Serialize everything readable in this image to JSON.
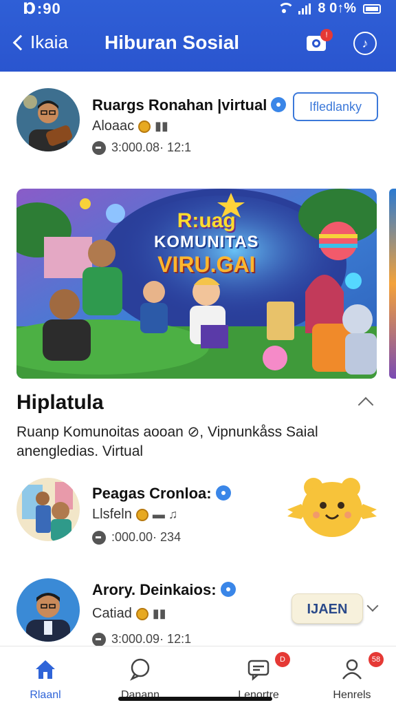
{
  "status_bar": {
    "time": "Ɒ:90",
    "right_text": "8 0↑%"
  },
  "header": {
    "back_label": "Ikaia",
    "title": "Hiburan Sosial",
    "camera_badge": "!"
  },
  "profiles": [
    {
      "name": "Ruargs Ronahan |virtual",
      "sub": "Aloaac",
      "meta": "3:000.08· 12:1",
      "follow_label": "Ifledlanky"
    },
    {
      "name": "Peagas Cronloa:",
      "sub": "Llsfeln",
      "meta": ":000.00· 234"
    },
    {
      "name": "Arory. Deinkaios:",
      "sub": "Catiad",
      "meta": "3:000.09· 12:1",
      "join_label": "IJAEN"
    }
  ],
  "banner": {
    "line1": "R:uag",
    "line2": "KOMUNITAS",
    "line3": "VIRU.GAI"
  },
  "section": {
    "title": "Hiplatula",
    "description": "Ruanp Komunoitas aooan ⊘, Vipnunkåss Saial anenglediаs. Virtual"
  },
  "bottom_nav": [
    {
      "label": "Rlaanl",
      "icon": "home-icon",
      "active": true
    },
    {
      "label": "Danann",
      "icon": "chat-bubble-icon"
    },
    {
      "label": "Lenortre",
      "icon": "message-icon",
      "badge": "D"
    },
    {
      "label": "Henrels",
      "icon": "profile-icon",
      "badge": "58"
    }
  ],
  "colors": {
    "header": "#2a55cf",
    "accent": "#3b78d9",
    "badge": "#e53935"
  }
}
